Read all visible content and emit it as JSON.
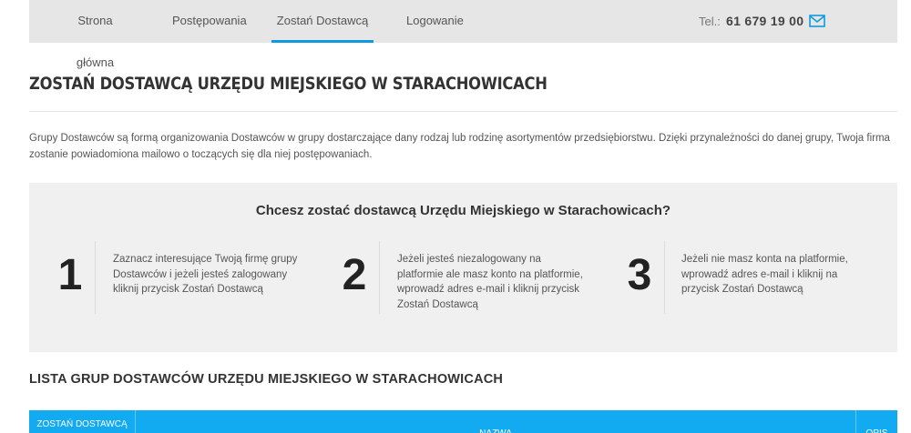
{
  "nav": {
    "items": [
      {
        "label": "Strona główna"
      },
      {
        "label": "Postępowania"
      },
      {
        "label": "Zostań Dostawcą"
      },
      {
        "label": "Logowanie"
      }
    ],
    "active_index": 2,
    "tel_label": "Tel.:",
    "tel_number": "61 679 19 00",
    "mail_icon": "mail-icon"
  },
  "page": {
    "title": "ZOSTAŃ DOSTAWCĄ URZĘDU MIEJSKIEGO W STARACHOWICACH",
    "intro": "Grupy Dostawców są formą organizowania Dostawców w grupy dostarczające dany rodzaj lub rodzinę asortymentów przedsiębiorstwu. Dzięki przynależności do danej grupy, Twoja firma zostanie powiadomiona mailowo o toczących się dla niej postępowaniach."
  },
  "steps_panel": {
    "title": "Chcesz zostać dostawcą Urzędu Miejskiego w Starachowicach?",
    "steps": [
      {
        "number": "1",
        "text": "Zaznacz interesujące Twoją firmę grupy Dostawców i jeżeli jesteś zalogowany kliknij przycisk Zostań Dostawcą"
      },
      {
        "number": "2",
        "text": "Jeżeli jesteś niezalogowany na platformie ale masz konto na platformie, wprowadź adres e-mail i kliknij przycisk Zostań Dostawcą"
      },
      {
        "number": "3",
        "text": "Jeżeli nie masz konta na platformie, wprowadź adres e-mail i kliknij na przycisk Zostań Dostawcą"
      }
    ]
  },
  "list": {
    "title": "LISTA GRUP DOSTAWCÓW URZĘDU MIEJSKIEGO W STARACHOWICACH",
    "columns": {
      "join": "ZOSTAŃ DOSTAWCĄ",
      "name": "NAZWA",
      "desc": "OPIS"
    }
  },
  "colors": {
    "accent": "#0e9ae0",
    "table_header": "#12aaf0",
    "nav_bg": "#e6e6e6",
    "panel_bg": "#f0f0f0"
  }
}
